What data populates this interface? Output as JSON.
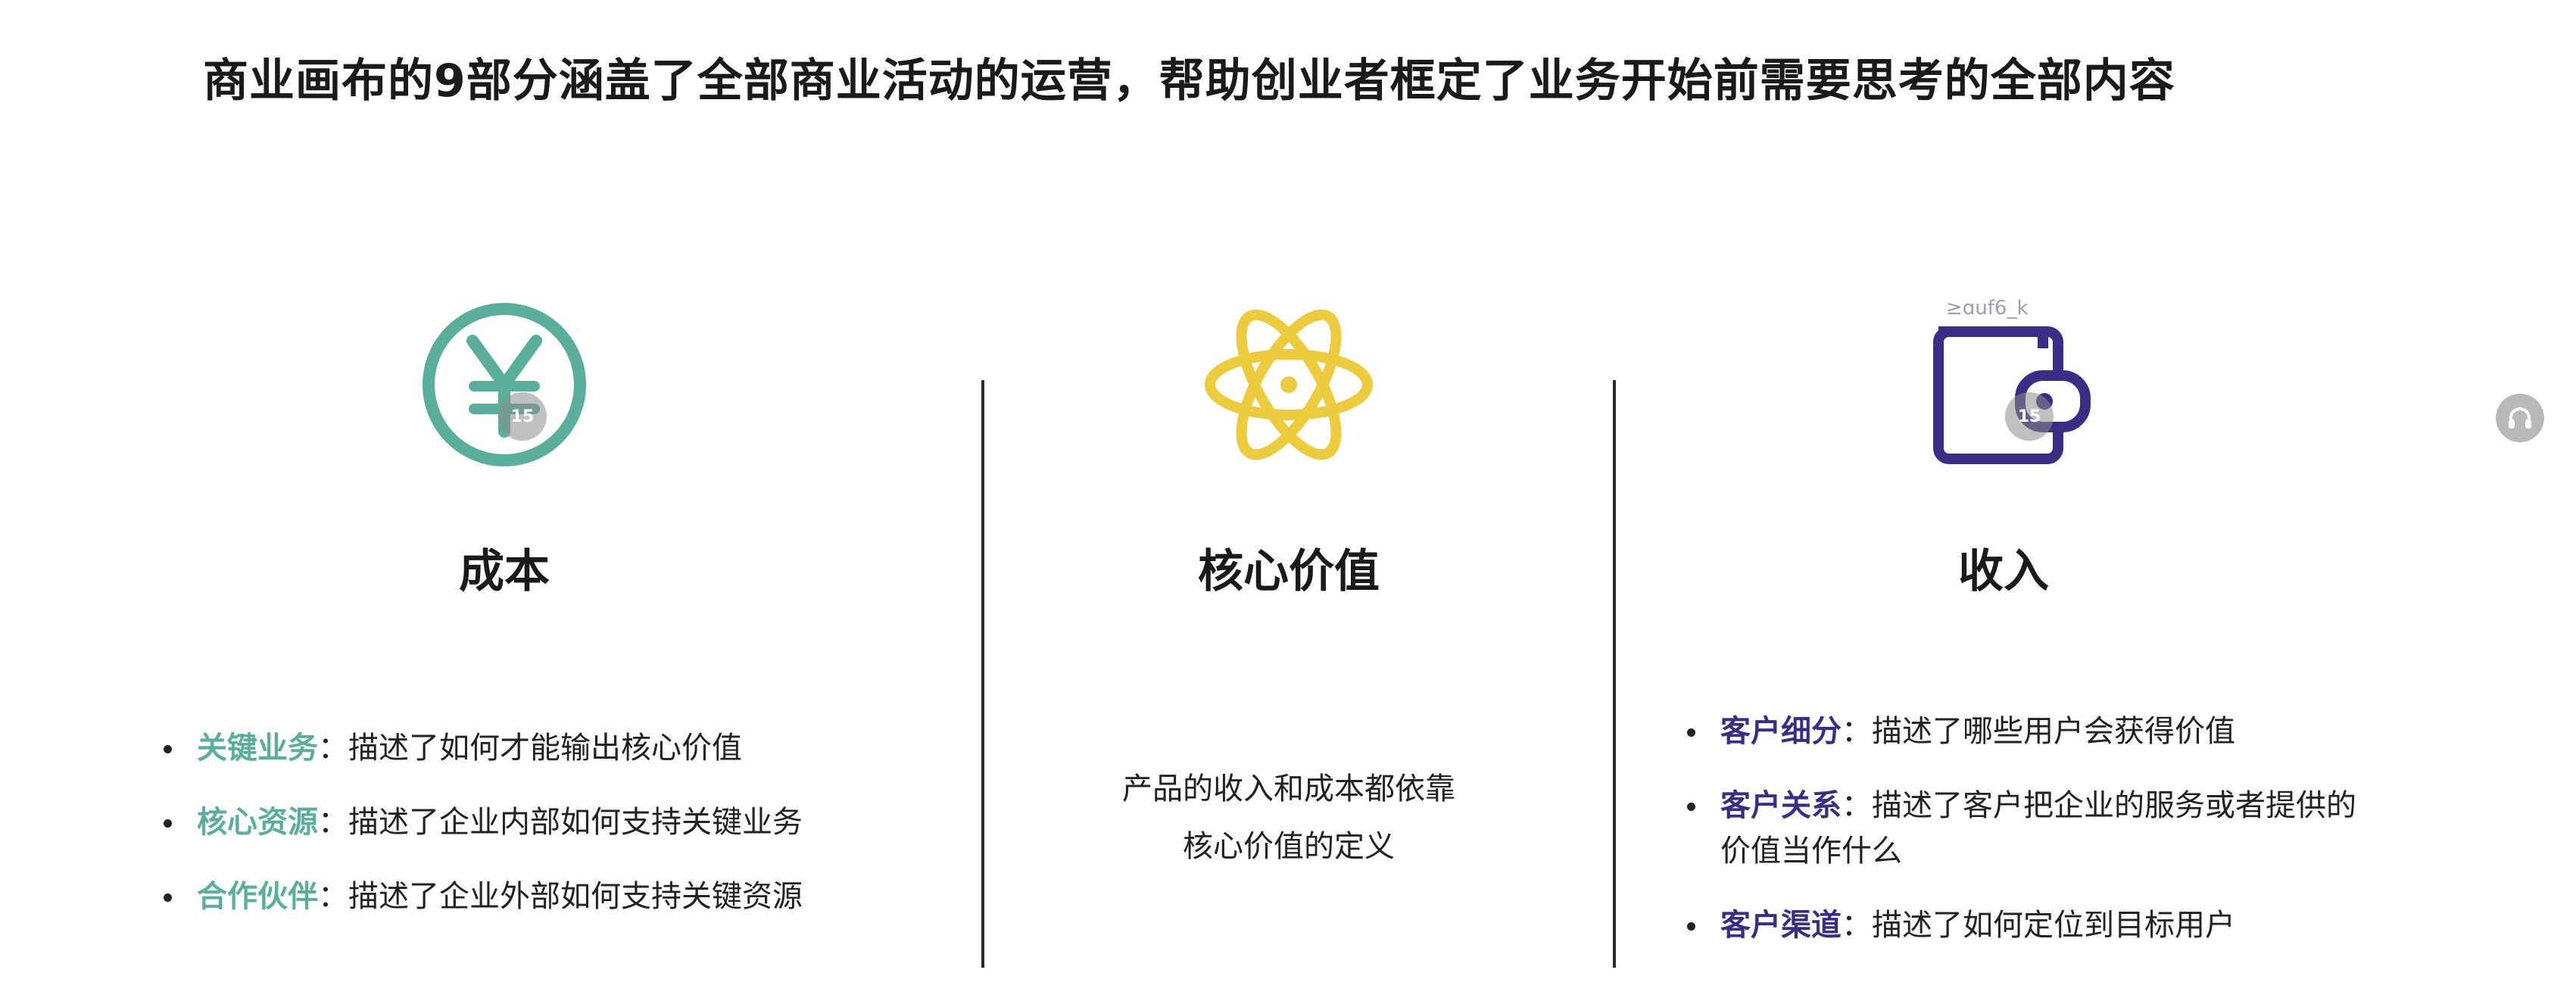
{
  "headline": "商业画布的9部分涵盖了全部商业活动的运营，帮助创业者框定了业务开始前需要思考的全部内容",
  "columns": {
    "cost": {
      "title": "成本",
      "icon": "yen-icon",
      "color": "#5aaf9c",
      "items": [
        {
          "term": "关键业务",
          "desc": "：描述了如何才能输出核心价值"
        },
        {
          "term": "核心资源",
          "desc": "：描述了企业内部如何支持关键业务"
        },
        {
          "term": "合作伙伴",
          "desc": "：描述了企业外部如何支持关键资源"
        }
      ]
    },
    "value": {
      "title": "核心价值",
      "icon": "atom-icon",
      "color": "#eccc3c",
      "text_line1": "产品的收入和成本都依靠",
      "text_line2": "核心价值的定义"
    },
    "revenue": {
      "title": "收入",
      "icon": "wallet-icon",
      "color": "#3b2d86",
      "items": [
        {
          "term": "客户细分",
          "desc": "：描述了哪些用户会获得价值"
        },
        {
          "term": "客户关系",
          "desc": "：描述了客户把企业的服务或者提供的",
          "desc2": "价值当作什么"
        },
        {
          "term": "客户渠道",
          "desc": "：描述了如何定位到目标用户"
        }
      ]
    }
  },
  "overlays": {
    "replay_label": "15",
    "watermark_fragment": "≥ɑuf6_k"
  }
}
